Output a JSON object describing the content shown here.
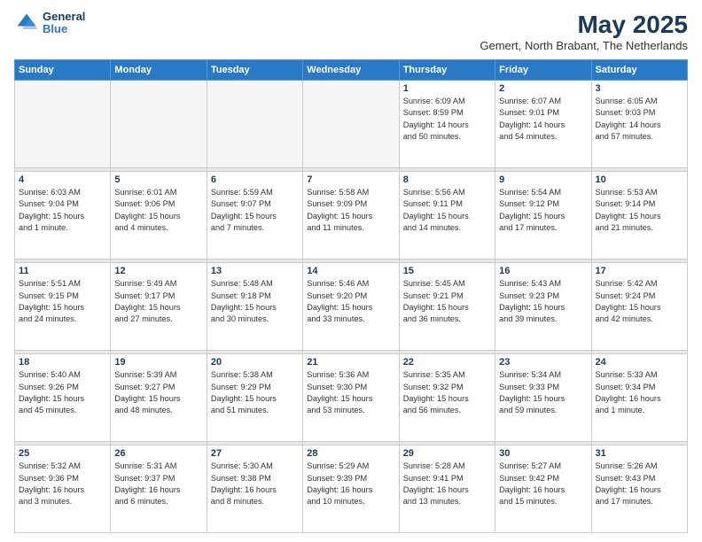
{
  "header": {
    "logo_general": "General",
    "logo_blue": "Blue",
    "month_title": "May 2025",
    "location": "Gemert, North Brabant, The Netherlands"
  },
  "weekdays": [
    "Sunday",
    "Monday",
    "Tuesday",
    "Wednesday",
    "Thursday",
    "Friday",
    "Saturday"
  ],
  "weeks": [
    [
      {
        "day": "",
        "info": ""
      },
      {
        "day": "",
        "info": ""
      },
      {
        "day": "",
        "info": ""
      },
      {
        "day": "",
        "info": ""
      },
      {
        "day": "1",
        "info": "Sunrise: 6:09 AM\nSunset: 8:59 PM\nDaylight: 14 hours\nand 50 minutes."
      },
      {
        "day": "2",
        "info": "Sunrise: 6:07 AM\nSunset: 9:01 PM\nDaylight: 14 hours\nand 54 minutes."
      },
      {
        "day": "3",
        "info": "Sunrise: 6:05 AM\nSunset: 9:03 PM\nDaylight: 14 hours\nand 57 minutes."
      }
    ],
    [
      {
        "day": "4",
        "info": "Sunrise: 6:03 AM\nSunset: 9:04 PM\nDaylight: 15 hours\nand 1 minute."
      },
      {
        "day": "5",
        "info": "Sunrise: 6:01 AM\nSunset: 9:06 PM\nDaylight: 15 hours\nand 4 minutes."
      },
      {
        "day": "6",
        "info": "Sunrise: 5:59 AM\nSunset: 9:07 PM\nDaylight: 15 hours\nand 7 minutes."
      },
      {
        "day": "7",
        "info": "Sunrise: 5:58 AM\nSunset: 9:09 PM\nDaylight: 15 hours\nand 11 minutes."
      },
      {
        "day": "8",
        "info": "Sunrise: 5:56 AM\nSunset: 9:11 PM\nDaylight: 15 hours\nand 14 minutes."
      },
      {
        "day": "9",
        "info": "Sunrise: 5:54 AM\nSunset: 9:12 PM\nDaylight: 15 hours\nand 17 minutes."
      },
      {
        "day": "10",
        "info": "Sunrise: 5:53 AM\nSunset: 9:14 PM\nDaylight: 15 hours\nand 21 minutes."
      }
    ],
    [
      {
        "day": "11",
        "info": "Sunrise: 5:51 AM\nSunset: 9:15 PM\nDaylight: 15 hours\nand 24 minutes."
      },
      {
        "day": "12",
        "info": "Sunrise: 5:49 AM\nSunset: 9:17 PM\nDaylight: 15 hours\nand 27 minutes."
      },
      {
        "day": "13",
        "info": "Sunrise: 5:48 AM\nSunset: 9:18 PM\nDaylight: 15 hours\nand 30 minutes."
      },
      {
        "day": "14",
        "info": "Sunrise: 5:46 AM\nSunset: 9:20 PM\nDaylight: 15 hours\nand 33 minutes."
      },
      {
        "day": "15",
        "info": "Sunrise: 5:45 AM\nSunset: 9:21 PM\nDaylight: 15 hours\nand 36 minutes."
      },
      {
        "day": "16",
        "info": "Sunrise: 5:43 AM\nSunset: 9:23 PM\nDaylight: 15 hours\nand 39 minutes."
      },
      {
        "day": "17",
        "info": "Sunrise: 5:42 AM\nSunset: 9:24 PM\nDaylight: 15 hours\nand 42 minutes."
      }
    ],
    [
      {
        "day": "18",
        "info": "Sunrise: 5:40 AM\nSunset: 9:26 PM\nDaylight: 15 hours\nand 45 minutes."
      },
      {
        "day": "19",
        "info": "Sunrise: 5:39 AM\nSunset: 9:27 PM\nDaylight: 15 hours\nand 48 minutes."
      },
      {
        "day": "20",
        "info": "Sunrise: 5:38 AM\nSunset: 9:29 PM\nDaylight: 15 hours\nand 51 minutes."
      },
      {
        "day": "21",
        "info": "Sunrise: 5:36 AM\nSunset: 9:30 PM\nDaylight: 15 hours\nand 53 minutes."
      },
      {
        "day": "22",
        "info": "Sunrise: 5:35 AM\nSunset: 9:32 PM\nDaylight: 15 hours\nand 56 minutes."
      },
      {
        "day": "23",
        "info": "Sunrise: 5:34 AM\nSunset: 9:33 PM\nDaylight: 15 hours\nand 59 minutes."
      },
      {
        "day": "24",
        "info": "Sunrise: 5:33 AM\nSunset: 9:34 PM\nDaylight: 16 hours\nand 1 minute."
      }
    ],
    [
      {
        "day": "25",
        "info": "Sunrise: 5:32 AM\nSunset: 9:36 PM\nDaylight: 16 hours\nand 3 minutes."
      },
      {
        "day": "26",
        "info": "Sunrise: 5:31 AM\nSunset: 9:37 PM\nDaylight: 16 hours\nand 6 minutes."
      },
      {
        "day": "27",
        "info": "Sunrise: 5:30 AM\nSunset: 9:38 PM\nDaylight: 16 hours\nand 8 minutes."
      },
      {
        "day": "28",
        "info": "Sunrise: 5:29 AM\nSunset: 9:39 PM\nDaylight: 16 hours\nand 10 minutes."
      },
      {
        "day": "29",
        "info": "Sunrise: 5:28 AM\nSunset: 9:41 PM\nDaylight: 16 hours\nand 13 minutes."
      },
      {
        "day": "30",
        "info": "Sunrise: 5:27 AM\nSunset: 9:42 PM\nDaylight: 16 hours\nand 15 minutes."
      },
      {
        "day": "31",
        "info": "Sunrise: 5:26 AM\nSunset: 9:43 PM\nDaylight: 16 hours\nand 17 minutes."
      }
    ]
  ]
}
